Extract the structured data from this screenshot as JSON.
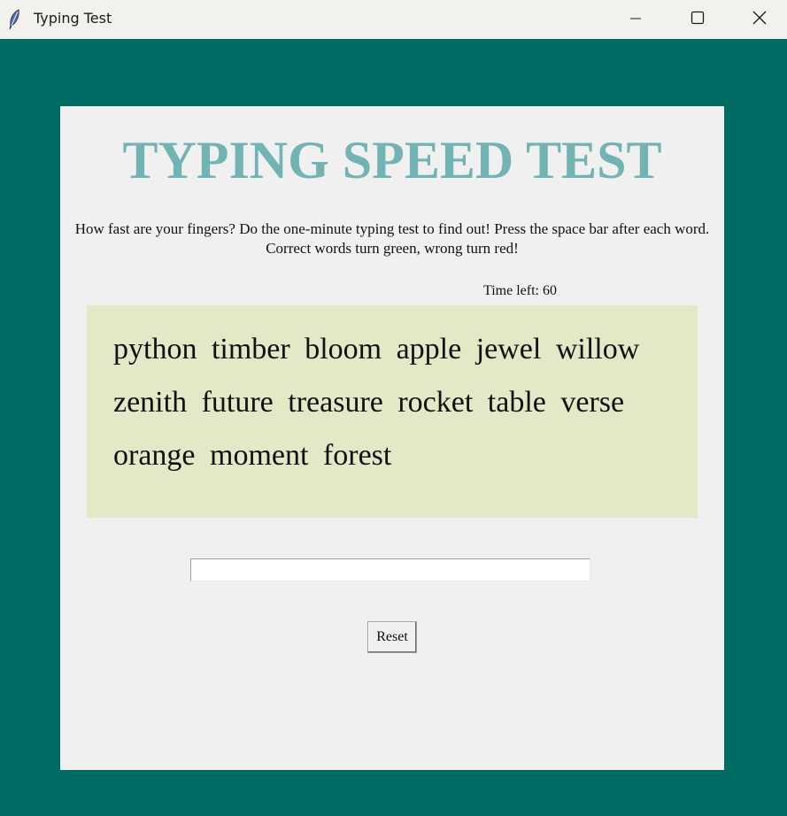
{
  "window": {
    "title": "Typing Test",
    "app_icon": "feather-icon",
    "controls": [
      "minimize-icon",
      "maximize-icon",
      "close-icon"
    ]
  },
  "main": {
    "heading": "TYPING SPEED TEST",
    "instructions": "How fast are your fingers? Do the one-minute typing test to find out! Press the space bar after each word. Correct words turn green, wrong turn red!",
    "timer": "Time left: 60",
    "words": "python  timber  bloom  apple  jewel  willow  zenith  future  treasure  rocket  table  verse  orange  moment  forest",
    "input": {
      "value": "",
      "placeholder": ""
    },
    "reset_label": "Reset"
  },
  "colors": {
    "background": "#006b63",
    "frame": "#f0f0f0",
    "heading": "#72b3b3",
    "words_panel": "#e5e8c6",
    "titlebar": "#f3f1ec"
  }
}
